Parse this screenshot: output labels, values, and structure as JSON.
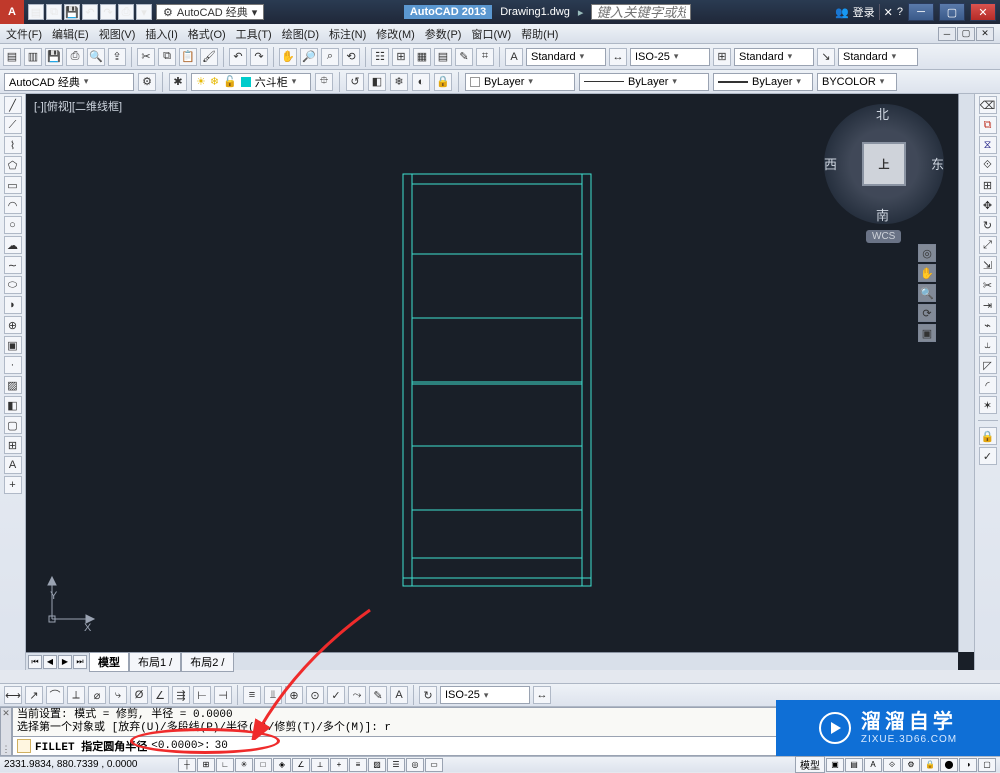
{
  "title": {
    "workspace": "AutoCAD 经典",
    "app": "AutoCAD 2013",
    "doc": "Drawing1.dwg",
    "search_ph": "键入关键字或短语",
    "login": "登录"
  },
  "menu": [
    "文件(F)",
    "编辑(E)",
    "视图(V)",
    "插入(I)",
    "格式(O)",
    "工具(T)",
    "绘图(D)",
    "标注(N)",
    "修改(M)",
    "参数(P)",
    "窗口(W)",
    "帮助(H)"
  ],
  "row2": {
    "styles": {
      "text": "Standard",
      "dim": "ISO-25",
      "table": "Standard",
      "mleader": "Standard"
    }
  },
  "row3": {
    "workspace": "AutoCAD 经典",
    "layer": "六斗柜",
    "props": {
      "layer": "ByLayer",
      "ltype": "ByLayer",
      "lweight": "ByLayer",
      "color": "BYCOLOR"
    }
  },
  "canvas": {
    "viewlabel": "[-][俯视][二维线框]"
  },
  "viewcube": {
    "n": "北",
    "s": "南",
    "e": "东",
    "w": "西",
    "top": "上",
    "wcs": "WCS"
  },
  "axes": {
    "x": "X",
    "y": "Y"
  },
  "tabs": {
    "model": "模型",
    "layout1": "布局1",
    "layout2": "布局2"
  },
  "dimrow": {
    "style": "ISO-25"
  },
  "cmd": {
    "hist1": "当前设置: 模式 = 修剪, 半径 = 0.0000",
    "hist2": "选择第一个对象或 [放弃(U)/多段线(P)/半径(R)/修剪(T)/多个(M)]: r",
    "prompt": "FILLET 指定圆角半径",
    "default": "<0.0000>:",
    "input": "30"
  },
  "status": {
    "coord": "2331.9834, 880.7339 , 0.0000",
    "rlabel": "模型"
  },
  "brand": {
    "t1": "溜溜自学",
    "t2": "ZIXUE.3D66.COM"
  }
}
